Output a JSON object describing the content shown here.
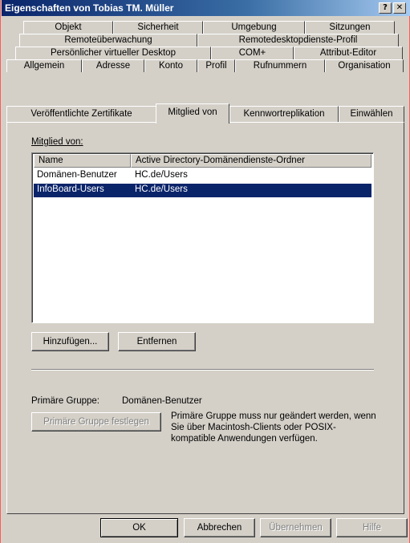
{
  "window": {
    "title": "Eigenschaften von Tobias TM. Müller",
    "help_glyph": "?",
    "close_glyph": "✕"
  },
  "tabs": {
    "row1": [
      "Objekt",
      "Sicherheit",
      "Umgebung",
      "Sitzungen"
    ],
    "row2": [
      "Remoteüberwachung",
      "Remotedesktopdienste-Profil"
    ],
    "row3": [
      "Persönlicher virtueller Desktop",
      "COM+",
      "Attribut-Editor"
    ],
    "row4": [
      "Allgemein",
      "Adresse",
      "Konto",
      "Profil",
      "Rufnummern",
      "Organisation"
    ],
    "row5": [
      "Veröffentlichte Zertifikate",
      "Mitglied von",
      "Kennwortreplikation",
      "Einwählen"
    ],
    "active": "Mitglied von"
  },
  "member_of": {
    "label": "Mitglied von:",
    "columns": [
      "Name",
      "Active Directory-Domänendienste-Ordner"
    ],
    "rows": [
      {
        "name": "Domänen-Benutzer",
        "folder": "HC.de/Users",
        "selected": false
      },
      {
        "name": "InfoBoard-Users",
        "folder": "HC.de/Users",
        "selected": true
      }
    ],
    "add_button": "Hinzufügen...",
    "remove_button": "Entfernen"
  },
  "primary_group": {
    "label": "Primäre Gruppe:",
    "value": "Domänen-Benutzer",
    "set_button": "Primäre Gruppe festlegen",
    "description": "Primäre Gruppe muss nur geändert werden, wenn Sie über Macintosh-Clients oder POSIX-kompatible Anwendungen verfügen."
  },
  "footer": {
    "ok": "OK",
    "cancel": "Abbrechen",
    "apply": "Übernehmen",
    "help": "Hilfe"
  },
  "colors": {
    "titlebar_start": "#0a246a",
    "selection": "#0a246a",
    "face": "#d4d0c8"
  }
}
